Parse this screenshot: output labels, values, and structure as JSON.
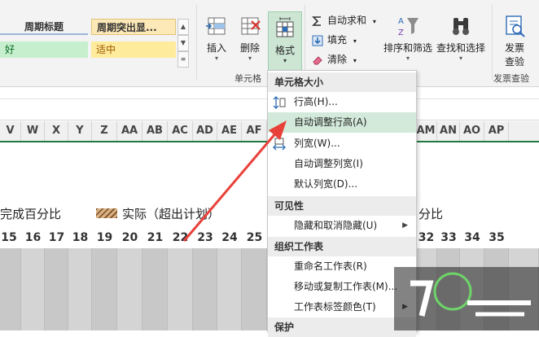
{
  "styles": {
    "title1": "周期标题",
    "title2": "周期突出显...",
    "good": "好",
    "neutral": "适中"
  },
  "ribbon": {
    "insert": "插入",
    "delete": "删除",
    "format": "格式",
    "cells_group": "单元格",
    "autosum": "自动求和",
    "fill": "填充",
    "clear": "清除",
    "sort_filter": "排序和筛选",
    "find_select": "查找和选择",
    "invoice_check_line1": "发票",
    "invoice_check_line2": "查验",
    "invoice_group": "发票查验"
  },
  "columns": [
    "V",
    "W",
    "X",
    "Y",
    "Z",
    "AA",
    "AB",
    "AC",
    "AD",
    "AE",
    "AF",
    "AM",
    "AN",
    "AO",
    "AP"
  ],
  "legend": {
    "complete_pct": "完成百分比",
    "actual_over": "实际（超出计划）",
    "pct_tail": "分比"
  },
  "days": [
    "15",
    "16",
    "17",
    "18",
    "19",
    "20",
    "21",
    "22",
    "23",
    "24",
    "25",
    "32",
    "33",
    "34",
    "35"
  ],
  "menu": {
    "section_cell_size": "单元格大小",
    "row_height": "行高(H)...",
    "autofit_row": "自动调整行高(A)",
    "col_width": "列宽(W)...",
    "autofit_col": "自动调整列宽(I)",
    "default_width": "默认列宽(D)...",
    "section_visibility": "可见性",
    "hide_unhide": "隐藏和取消隐藏(U)",
    "section_organize": "组织工作表",
    "rename": "重命名工作表(R)",
    "move_copy": "移动或复制工作表(M)...",
    "tab_color": "工作表标签颜色(T)",
    "section_protect": "保护"
  },
  "colors": {
    "accent_green": "#1f7a3f",
    "highlight": "#d3eadb",
    "arrow_red": "#e8413a"
  }
}
